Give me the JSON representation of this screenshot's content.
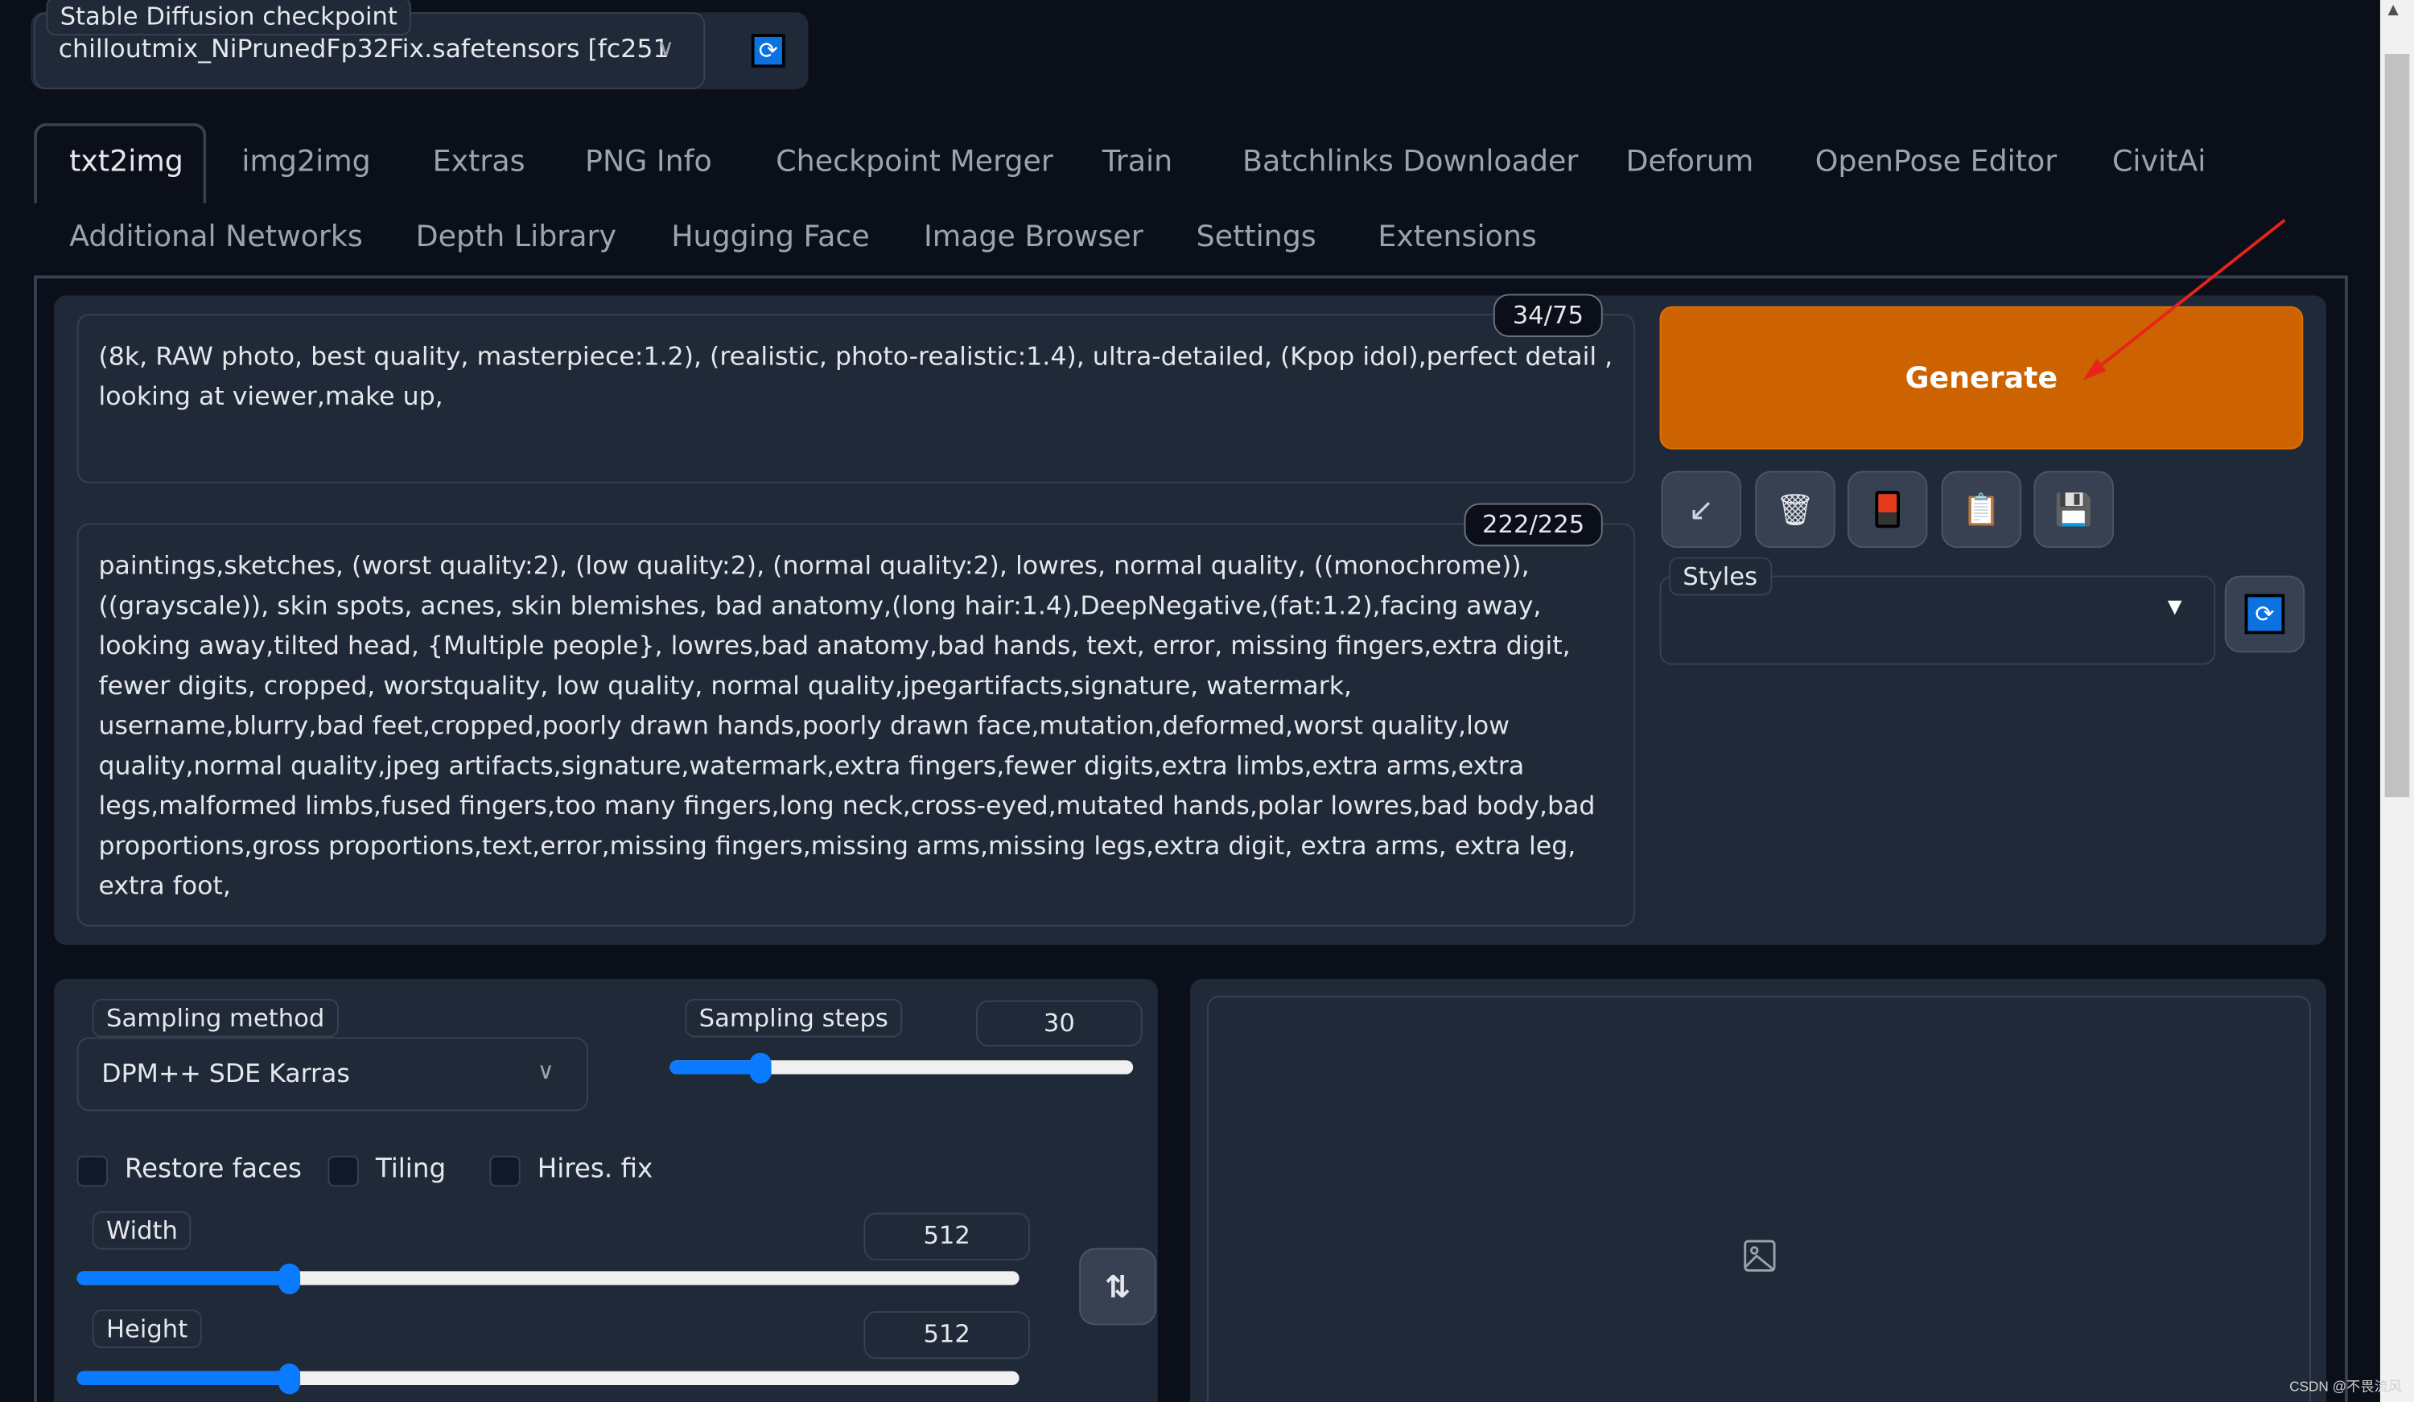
{
  "checkpoint": {
    "label": "Stable Diffusion checkpoint",
    "value": "chilloutmix_NiPrunedFp32Fix.safetensors [fc251",
    "refresh_icon": "refresh-icon"
  },
  "tabs_row1": [
    "txt2img",
    "img2img",
    "Extras",
    "PNG Info",
    "Checkpoint Merger",
    "Train",
    "Batchlinks Downloader",
    "Deforum",
    "OpenPose Editor",
    "CivitAi"
  ],
  "tabs_row2": [
    "Additional Networks",
    "Depth Library",
    "Hugging Face",
    "Image Browser",
    "Settings",
    "Extensions"
  ],
  "selected_tab": "txt2img",
  "prompt": {
    "value": "(8k, RAW photo, best quality, masterpiece:1.2), (realistic, photo-realistic:1.4), ultra-detailed, (Kpop idol),perfect detail , looking at viewer,make up,",
    "counter": "34/75"
  },
  "negative_prompt": {
    "value": "paintings,sketches, (worst quality:2), (low quality:2), (normal quality:2), lowres, normal quality, ((monochrome)), ((grayscale)), skin spots, acnes, skin blemishes, bad anatomy,(long hair:1.4),DeepNegative,(fat:1.2),facing away, looking away,tilted head, {Multiple people}, lowres,bad anatomy,bad hands, text, error, missing fingers,extra digit, fewer digits, cropped, worstquality, low quality, normal quality,jpegartifacts,signature, watermark, username,blurry,bad feet,cropped,poorly drawn hands,poorly drawn face,mutation,deformed,worst quality,low quality,normal quality,jpeg artifacts,signature,watermark,extra fingers,fewer digits,extra limbs,extra arms,extra legs,malformed limbs,fused fingers,too many fingers,long neck,cross-eyed,mutated hands,polar lowres,bad body,bad proportions,gross proportions,text,error,missing fingers,missing arms,missing legs,extra digit, extra arms, extra leg, extra foot,",
    "counter": "222/225"
  },
  "generate": {
    "label": "Generate",
    "color": "#cd6200"
  },
  "tool_buttons": [
    "arrow-down-left-icon",
    "trash-icon",
    "card-icon",
    "clipboard-icon",
    "floppy-save-icon"
  ],
  "styles": {
    "label": "Styles",
    "value": ""
  },
  "sampling_method": {
    "label": "Sampling method",
    "value": "DPM++ SDE Karras"
  },
  "sampling_steps": {
    "label": "Sampling steps",
    "value": "30",
    "min": 1,
    "max": 150
  },
  "checkboxes": [
    {
      "label": "Restore faces",
      "checked": false
    },
    {
      "label": "Tiling",
      "checked": false
    },
    {
      "label": "Hires. fix",
      "checked": false
    }
  ],
  "width": {
    "label": "Width",
    "value": "512",
    "min": 64,
    "max": 2048
  },
  "height": {
    "label": "Height",
    "value": "512",
    "min": 64,
    "max": 2048
  },
  "watermark": "CSDN @不畏流风",
  "colors": {
    "accent": "#0a7aff",
    "background": "#0b0f19",
    "panel": "#1f2937",
    "annotation_arrow": "#e8231c"
  }
}
